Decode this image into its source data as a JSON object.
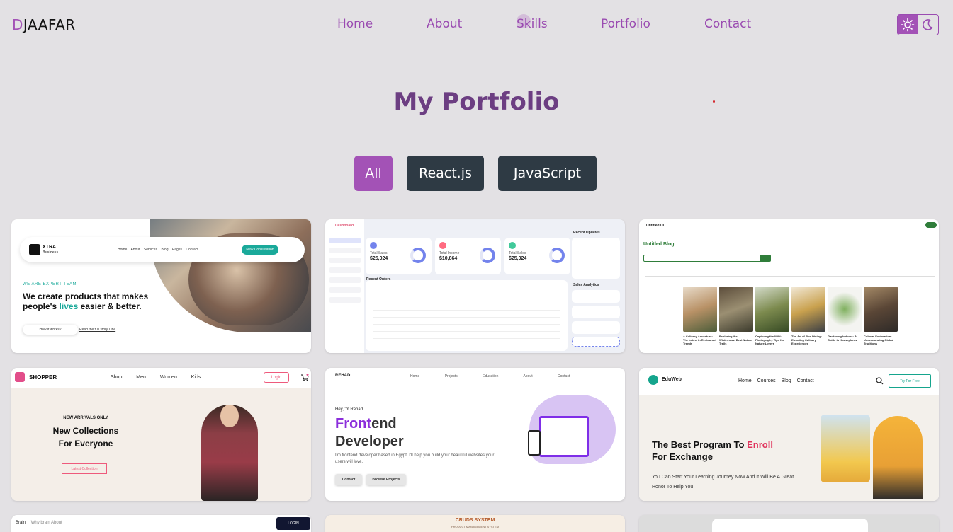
{
  "header": {
    "logo_first": "D",
    "logo_rest": "JAAFAR",
    "nav": [
      "Home",
      "About",
      "Skills",
      "Portfolio",
      "Contact"
    ],
    "theme_icons": [
      "sun-icon",
      "moon-icon"
    ]
  },
  "page_title": "My Portfolio",
  "filters": [
    "All",
    "React.js",
    "JavaScript"
  ],
  "colors": {
    "accent": "#a352b6",
    "background": "#e3e1e4",
    "filter_dark": "#2e3a44",
    "title": "#6c3e82"
  },
  "cards": {
    "xtra": {
      "brand": "XTRA",
      "brand_sub": "Business",
      "menu": "Home About Services Blog Pages Contact",
      "cta": "New Consultation",
      "eyebrow": "WE ARE EXPERT TEAM",
      "headline_a": "We create products that makes people's ",
      "headline_hl": "lives",
      "headline_b": " easier & better.",
      "btn": "How it works?",
      "link": "Read the full story Line"
    },
    "dashboard": {
      "brand": "Dashboard",
      "recent_updates": "Recent Updates",
      "recent_orders": "Recent Orders",
      "sales_analytics": "Sales Analytics",
      "kpis": [
        {
          "label": "Total Sales",
          "value": "$25,024"
        },
        {
          "label": "Total Income",
          "value": "$10,864"
        },
        {
          "label": "Total Sales",
          "value": "$25,024"
        }
      ]
    },
    "blog": {
      "brand": "Untitled UI",
      "title": "Untitled Blog",
      "cards": [
        "A Culinary Adventure: The Latest in Restaurant Trends",
        "Exploring the Wilderness: Best Nature Trails",
        "Capturing the Wild: Photography Tips for Nature Lovers",
        "The Art of Fine Dining: Elevating Culinary Experiences",
        "Gardening Indoors: A Guide to Houseplants",
        "Cultural Exploration: Understanding Global Traditions"
      ]
    },
    "shopper": {
      "brand": "SHOPPER",
      "menu": "Shop Men Women Kids",
      "login": "Login",
      "arrivals": "NEW ARRIVALS ONLY",
      "collections": "New Collections For Everyone",
      "latest": "Latest Collection"
    },
    "rehad": {
      "brand": "REHAD",
      "menu": "Home Projects Education About Contact",
      "hey": "Hey,I'm Rehad",
      "frontend_p": "Front",
      "frontend_rest": "end",
      "developer": "Developer",
      "desc": "I'm frontend developer based in Egypt, I'll help you build your beautiful websites your users will love.",
      "contact": "Contact",
      "browse": "Browse Projects"
    },
    "eduweb": {
      "brand": "EduWeb",
      "menu": "Home Courses Blog Contact",
      "try": "Try For Free",
      "head_a": "The Best Program To ",
      "head_r": "Enroll",
      "head_b": " For Exchange",
      "sub": "You Can Start Your Learning Journey Now And It Will Be A Great Honor To Help You"
    },
    "brain": {
      "brand": "Brain",
      "menu": "Why brain   About",
      "login": "LOGIN"
    },
    "cruds": {
      "title": "CRUDS SYSTEM",
      "sub": "PRODUCT MANAGEMENT SYSTEM"
    }
  }
}
